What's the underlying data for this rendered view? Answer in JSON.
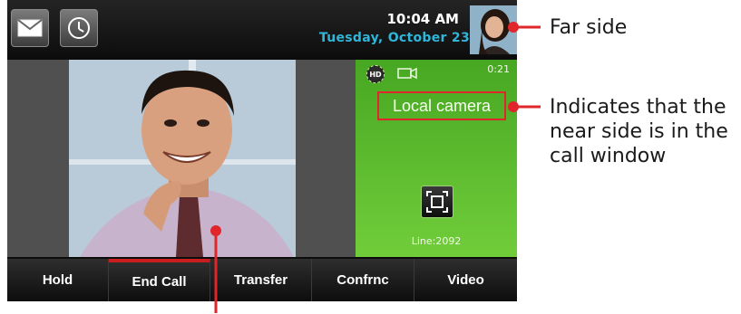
{
  "topbar": {
    "time": "10:04 AM",
    "date": "Tuesday, October 23",
    "icons": [
      "envelope-icon",
      "clock-icon"
    ]
  },
  "call": {
    "hd_badge": "HD",
    "timer": "0:21",
    "local_camera_label": "Local camera",
    "line": "Line:2092"
  },
  "softkeys": [
    {
      "label": "Hold"
    },
    {
      "label": "End Call",
      "active": true
    },
    {
      "label": "Transfer"
    },
    {
      "label": "Confrnc"
    },
    {
      "label": "Video"
    }
  ],
  "callouts": {
    "far_side": "Far side",
    "near_side": "Indicates that the near side is in the call window"
  },
  "colors": {
    "accent_green": "#5cbf2c",
    "highlight_red": "#e0262a",
    "date_blue": "#2fb6d9"
  }
}
